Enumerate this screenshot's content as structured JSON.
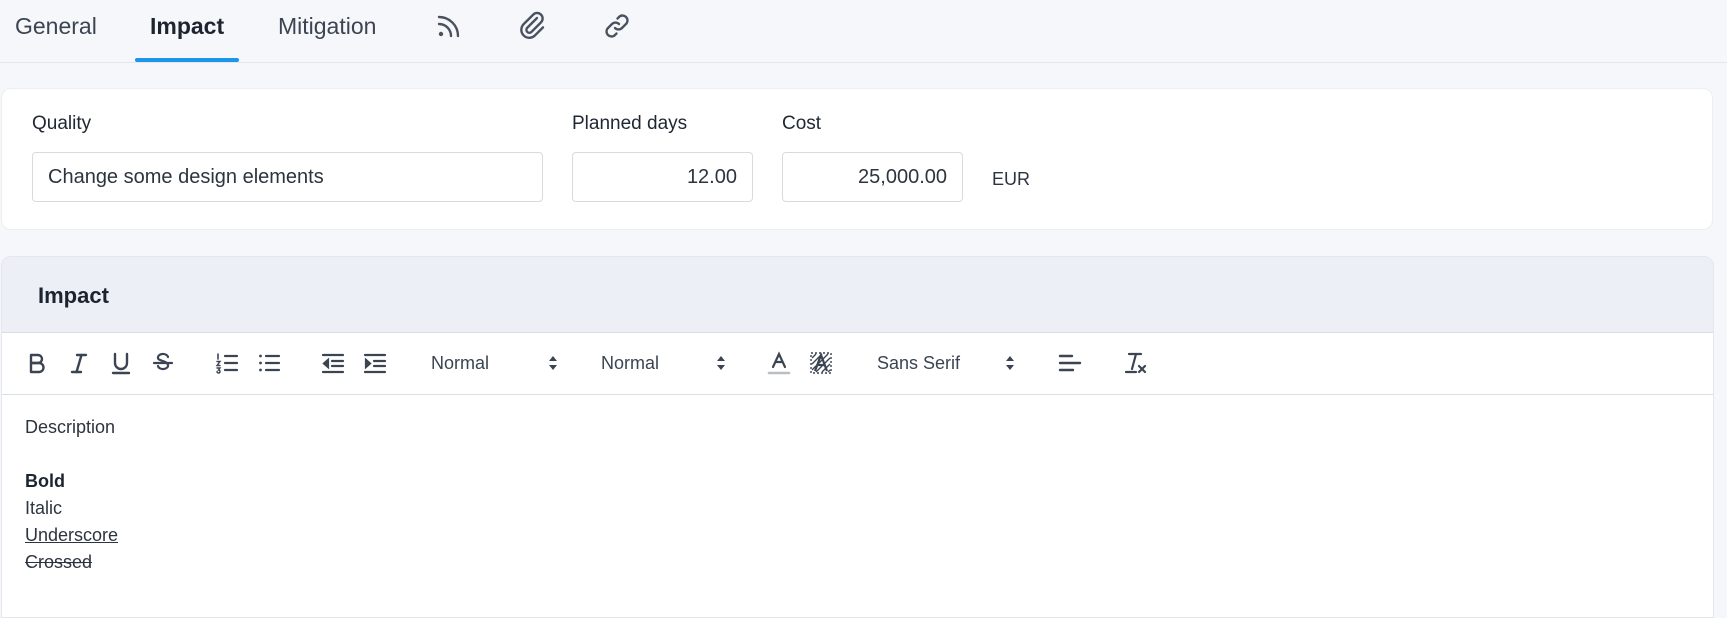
{
  "tabs": [
    {
      "label": "General"
    },
    {
      "label": "Impact",
      "active": true
    },
    {
      "label": "Mitigation"
    }
  ],
  "tab_icons": [
    "rss-icon",
    "paperclip-icon",
    "link-icon"
  ],
  "fields": {
    "quality": {
      "label": "Quality",
      "value": "Change some design elements"
    },
    "planned_days": {
      "label": "Planned days",
      "value": "12.00"
    },
    "cost": {
      "label": "Cost",
      "value": "25,000.00",
      "unit": "EUR"
    }
  },
  "impact": {
    "title": "Impact",
    "toolbar": {
      "header_select": "Normal",
      "size_select": "Normal",
      "font_select": "Sans Serif"
    },
    "content": {
      "line1": "Description",
      "bold": "Bold",
      "italic": "Italic",
      "underline": "Underscore",
      "strike": "Crossed"
    }
  },
  "colors": {
    "accent": "#1b96e8",
    "section_header_bg": "#eceff5",
    "page_bg": "#f6f7fa"
  }
}
